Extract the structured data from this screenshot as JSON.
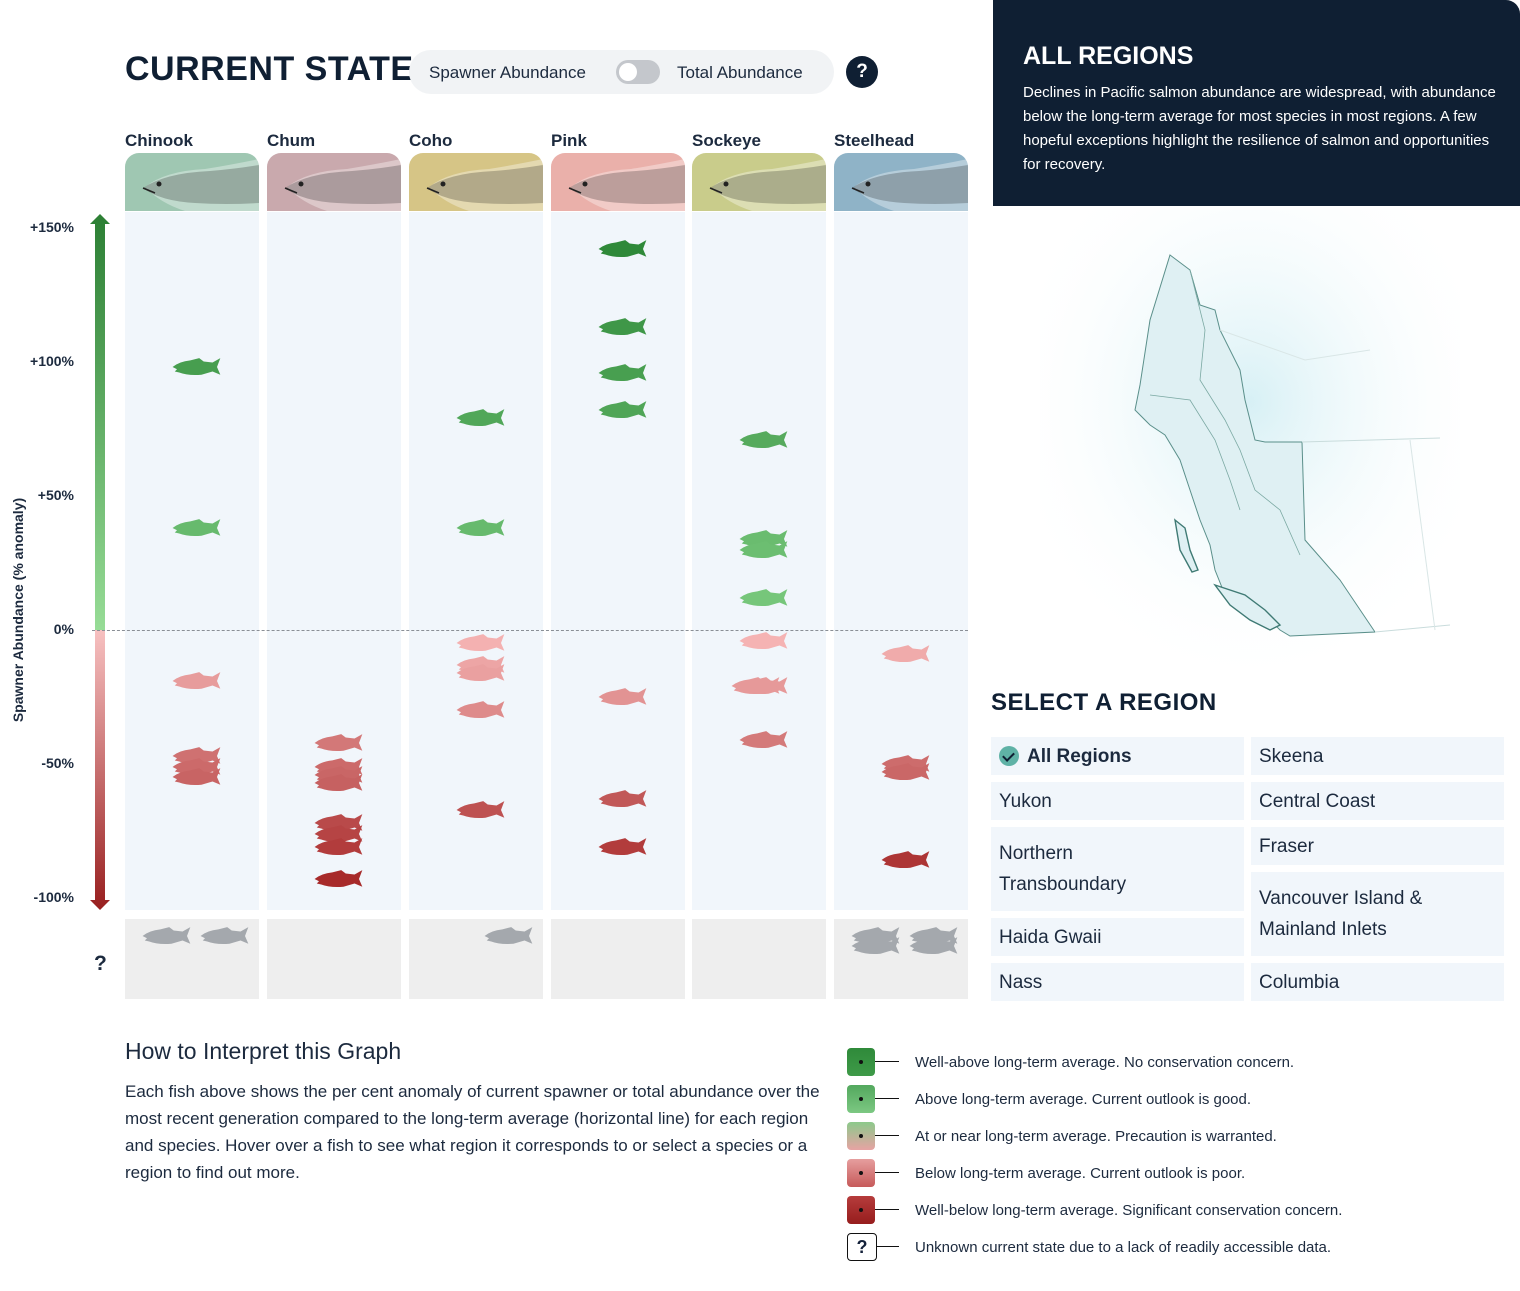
{
  "header": {
    "title": "CURRENT STATE",
    "toggle_left_label": "Spawner Abundance",
    "toggle_right_label": "Total Abundance",
    "toggle_state": "spawner",
    "help_label": "?"
  },
  "region_card": {
    "title": "ALL REGIONS",
    "description": "Declines in Pacific salmon abundance are widespread, with abundance below the long-term average for most species in most regions. A few hopeful exceptions highlight the resilience of salmon and opportunities for recovery."
  },
  "region_select": {
    "title": "SELECT A REGION",
    "left_column": [
      {
        "label": "All Regions",
        "selected": true
      },
      {
        "label": "Yukon",
        "selected": false
      },
      {
        "label": "Northern Transboundary",
        "selected": false
      },
      {
        "label": "Haida Gwaii",
        "selected": false
      },
      {
        "label": "Nass",
        "selected": false
      }
    ],
    "right_column": [
      {
        "label": "Skeena",
        "selected": false
      },
      {
        "label": "Central Coast",
        "selected": false
      },
      {
        "label": "Fraser",
        "selected": false
      },
      {
        "label": "Vancouver Island & Mainland Inlets",
        "selected": false
      },
      {
        "label": "Columbia",
        "selected": false
      }
    ]
  },
  "howto": {
    "title": "How to Interpret this Graph",
    "text": "Each fish above shows the per cent anomaly of current spawner or total abundance over the most recent generation compared to the long-term average (horizontal line) for each region and species. Hover over a fish to see what region it corresponds to or select a species or a region to find out more."
  },
  "legend": [
    {
      "label": "Well-above long-term average. No conservation concern.",
      "color_top": "#2f8a3a",
      "color_bottom": "#3e9a48",
      "icon": "swatch"
    },
    {
      "label": "Above long-term average. Current outlook is good.",
      "color_top": "#53a85e",
      "color_bottom": "#7cc882",
      "icon": "swatch"
    },
    {
      "label": "At or near long-term average. Precaution is warranted.",
      "color_top": "#8cc98b",
      "color_bottom": "#e7a3a3",
      "icon": "swatch"
    },
    {
      "label": "Below long-term average. Current outlook is poor.",
      "color_top": "#e69e9e",
      "color_bottom": "#c65a5a",
      "icon": "swatch"
    },
    {
      "label": "Well-below long-term average. Significant conservation concern.",
      "color_top": "#b63c3c",
      "color_bottom": "#961d1d",
      "icon": "swatch"
    },
    {
      "label": "Unknown current state due to a lack of readily accessible data.",
      "icon": "question-box"
    }
  ],
  "chart_data": {
    "type": "scatter",
    "title": "CURRENT STATE",
    "ylabel": "Spawner Abundance (% anomaly)",
    "ylim": [
      -100,
      150
    ],
    "yticks": [
      150,
      100,
      50,
      0,
      -50,
      -100
    ],
    "ytick_labels": [
      "+150%",
      "+100%",
      "+50%",
      "0%",
      "-50%",
      "-100%"
    ],
    "reference_line": 0,
    "unknown_row_label": "?",
    "categories": [
      "Chinook",
      "Chum",
      "Coho",
      "Pink",
      "Sockeye",
      "Steelhead"
    ],
    "category_colors": [
      "#9fc7b2",
      "#c9a9ad",
      "#d6c586",
      "#eab0aa",
      "#c9cc8b",
      "#8fb3c7"
    ],
    "series": [
      {
        "name": "Chinook",
        "values": [
          98,
          38,
          -19,
          -47,
          -51,
          -55
        ],
        "unknown_count": 2
      },
      {
        "name": "Chum",
        "values": [
          -42,
          -51,
          -54,
          -57,
          -72,
          -76,
          -81,
          -93
        ],
        "unknown_count": 0
      },
      {
        "name": "Coho",
        "values": [
          79,
          38,
          -5,
          -13,
          -16,
          -30,
          -67
        ],
        "unknown_count": 1
      },
      {
        "name": "Pink",
        "values": [
          142,
          113,
          96,
          82,
          -25,
          -63,
          -81
        ],
        "unknown_count": 0
      },
      {
        "name": "Sockeye",
        "values": [
          71,
          34,
          30,
          12,
          -4,
          -21,
          -21,
          -41
        ],
        "unknown_count": 0
      },
      {
        "name": "Steelhead",
        "values": [
          -9,
          -50,
          -53,
          -86
        ],
        "unknown_count": 4
      }
    ],
    "color_scale": {
      "well_above": "#2f8a3a",
      "above": "#6fbe72",
      "near": "#f3b7b7",
      "below": "#d27676",
      "well_below": "#a82a2a",
      "unknown": "#a4a8ad"
    }
  }
}
